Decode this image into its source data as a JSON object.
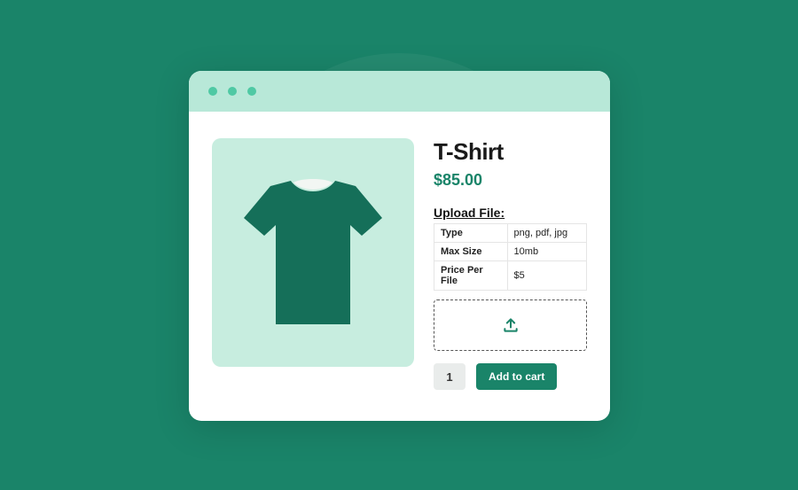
{
  "product": {
    "title": "T-Shirt",
    "price": "$85.00"
  },
  "upload": {
    "heading": "Upload File:",
    "specs": [
      {
        "label": "Type",
        "value": "png, pdf, jpg"
      },
      {
        "label": "Max Size",
        "value": "10mb"
      },
      {
        "label": "Price Per File",
        "value": "$5"
      }
    ]
  },
  "actions": {
    "quantity": "1",
    "add_to_cart": "Add to cart"
  },
  "colors": {
    "accent": "#1a8469",
    "pane": "#b8e8d8",
    "image_bg": "#c7eddf"
  }
}
